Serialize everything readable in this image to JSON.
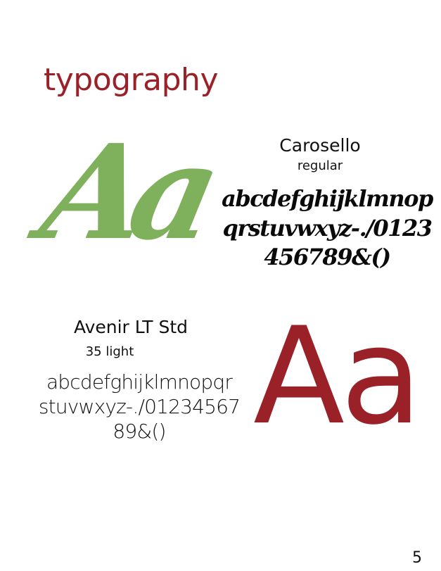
{
  "page": {
    "title": "typography",
    "page_number": "5"
  },
  "font_script": {
    "sample": "Aa",
    "name": "Carosello",
    "weight": "regular",
    "glyph_lines": [
      "abcdefghijklmnop",
      "qrstuvwxyz-./0123",
      "456789&()"
    ],
    "color": "#7fb05c"
  },
  "font_sans": {
    "sample": "Aa",
    "name": "Avenir LT Std",
    "weight": "35 light",
    "glyph_lines": [
      "abcdefghijklmnopqr",
      "stuvwxyz-./01234567",
      "89&()"
    ],
    "color": "#9b2128"
  },
  "colors": {
    "accent": "#9b2128",
    "green": "#7fb05c",
    "text": "#111111"
  }
}
